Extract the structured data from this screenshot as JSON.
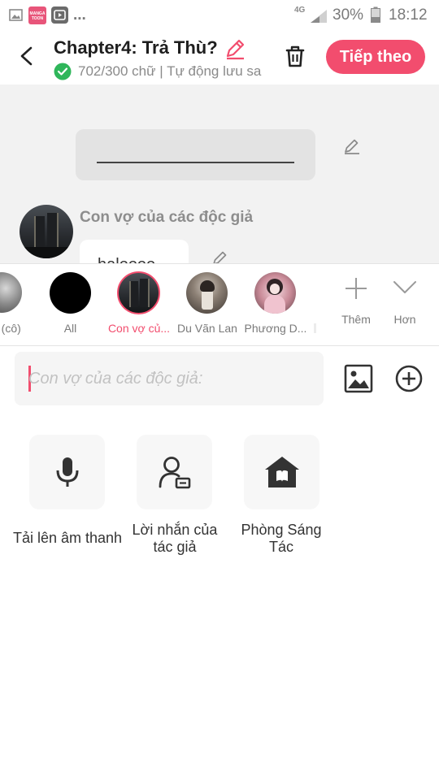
{
  "status_bar": {
    "dots": "...",
    "network": "4G",
    "battery": "30%",
    "time": "18:12"
  },
  "header": {
    "title": "Chapter4: Trả Thù?",
    "subtitle": "702/300 chữ | Tự động lưu sa",
    "next_label": "Tiếp theo"
  },
  "content": {
    "character_name": "Con vợ của các độc giả",
    "message_text": "haloooo"
  },
  "characters": [
    {
      "label": "n (cô)",
      "selected": false
    },
    {
      "label": "All",
      "selected": false
    },
    {
      "label": "Con vợ củ...",
      "selected": true
    },
    {
      "label": "Du Vãn Lan",
      "selected": false
    },
    {
      "label": "Phương D...",
      "selected": false
    }
  ],
  "character_actions": {
    "add_label": "Thêm",
    "more_label": "Hơn"
  },
  "input": {
    "placeholder": "Con vợ của các độc giả:"
  },
  "tools": [
    {
      "label": "Tải lên âm thanh",
      "icon": "microphone-icon"
    },
    {
      "label": "Lời nhắn của tác giả",
      "icon": "author-note-icon"
    },
    {
      "label": "Phòng Sáng Tác",
      "icon": "creation-room-icon"
    }
  ],
  "colors": {
    "accent": "#f24d6e",
    "check_green": "#2fb65a",
    "content_bg": "#f2f2f2"
  }
}
